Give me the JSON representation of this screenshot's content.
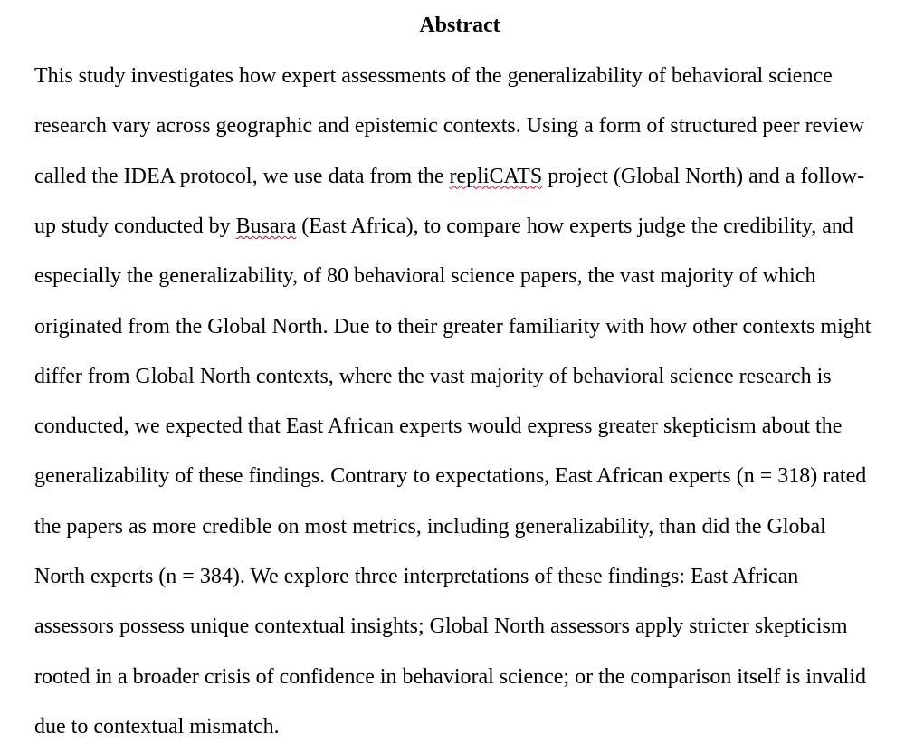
{
  "document": {
    "heading": "Abstract",
    "lines": [
      {
        "segments": [
          {
            "text": "This study investigates how expert assessments of the generalizability of behavioral science",
            "flag": false
          }
        ]
      },
      {
        "segments": [
          {
            "text": "research vary across geographic and epistemic contexts. Using a form of structured peer review",
            "flag": false
          }
        ]
      },
      {
        "segments": [
          {
            "text": "called the IDEA protocol, we use data from the ",
            "flag": false
          },
          {
            "text": "repliCATS",
            "flag": true
          },
          {
            "text": " project (Global North) and a follow-",
            "flag": false
          }
        ]
      },
      {
        "segments": [
          {
            "text": "up study conducted by ",
            "flag": false
          },
          {
            "text": "Busara",
            "flag": true
          },
          {
            "text": " (East Africa), to compare how experts judge the credibility, and",
            "flag": false
          }
        ]
      },
      {
        "segments": [
          {
            "text": "especially the generalizability, of 80 behavioral science papers, the vast majority of which",
            "flag": false
          }
        ]
      },
      {
        "segments": [
          {
            "text": "originated from the Global North. Due to their greater familiarity with how other contexts might",
            "flag": false
          }
        ]
      },
      {
        "segments": [
          {
            "text": "differ from Global North contexts, where the vast majority of behavioral science research is",
            "flag": false
          }
        ]
      },
      {
        "segments": [
          {
            "text": "conducted, we expected that East African experts would express greater skepticism about the",
            "flag": false
          }
        ]
      },
      {
        "segments": [
          {
            "text": "generalizability of these findings. Contrary to expectations, East African experts (n = 318) rated",
            "flag": false
          }
        ]
      },
      {
        "segments": [
          {
            "text": "the papers as more credible on most metrics, including generalizability, than did the Global",
            "flag": false
          }
        ]
      },
      {
        "segments": [
          {
            "text": "North experts (n = 384). We explore three interpretations of these findings: East African",
            "flag": false
          }
        ]
      },
      {
        "segments": [
          {
            "text": "assessors possess unique contextual insights; Global North assessors apply stricter skepticism",
            "flag": false
          }
        ]
      },
      {
        "segments": [
          {
            "text": "rooted in a broader crisis of confidence in behavioral science; or the comparison itself is invalid",
            "flag": false
          }
        ]
      },
      {
        "segments": [
          {
            "text": "due to contextual mismatch.",
            "flag": false
          }
        ]
      }
    ]
  },
  "colors": {
    "text": "#000000",
    "background": "#ffffff",
    "spellcheck_underline": "#d0021b"
  }
}
